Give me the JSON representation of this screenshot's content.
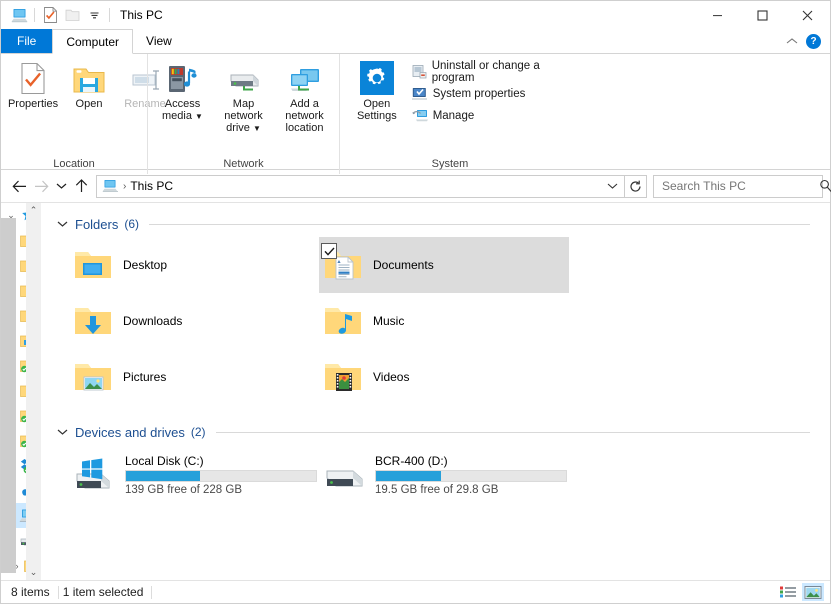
{
  "window": {
    "title": "This PC",
    "quick_access": [
      {
        "name": "this-pc-icon",
        "label": "This PC"
      },
      {
        "name": "properties-icon",
        "label": "Properties"
      },
      {
        "name": "new-folder-icon",
        "label": "New folder"
      },
      {
        "name": "customize-dropdown-icon",
        "label": "Customize Quick Access Toolbar"
      }
    ],
    "controls": {
      "minimize": "Minimize",
      "maximize": "Maximize",
      "close": "Close"
    }
  },
  "tabs": [
    {
      "label": "File",
      "type": "file"
    },
    {
      "label": "Computer",
      "type": "active"
    },
    {
      "label": "View",
      "type": "normal"
    }
  ],
  "tabrow_right": {
    "collapse_label": "Collapse the Ribbon",
    "help_label": "?"
  },
  "ribbon": {
    "groups": [
      {
        "label": "Location",
        "big_buttons": [
          {
            "label": "Properties",
            "icon": "properties-icon",
            "disabled": false,
            "caret": false
          },
          {
            "label": "Open",
            "icon": "open-folder-icon",
            "disabled": false,
            "caret": false
          },
          {
            "label": "Rename",
            "icon": "rename-icon",
            "disabled": true,
            "caret": false
          }
        ]
      },
      {
        "label": "Network",
        "big_buttons": [
          {
            "label": "Access media",
            "icon": "access-media-icon",
            "disabled": false,
            "caret": true
          },
          {
            "label": "Map network drive",
            "icon": "map-network-drive-icon",
            "disabled": false,
            "caret": true
          },
          {
            "label": "Add a network location",
            "icon": "add-network-location-icon",
            "disabled": false,
            "caret": false
          }
        ]
      },
      {
        "label": "System",
        "big_buttons": [
          {
            "label": "Open Settings",
            "icon": "settings-gear-icon",
            "disabled": false,
            "caret": false
          }
        ],
        "small_buttons": [
          {
            "label": "Uninstall or change a program",
            "icon": "uninstall-program-icon"
          },
          {
            "label": "System properties",
            "icon": "system-properties-icon"
          },
          {
            "label": "Manage",
            "icon": "manage-icon"
          }
        ]
      }
    ]
  },
  "addressbar": {
    "back_label": "Back",
    "forward_label": "Forward",
    "recent_label": "Recent locations",
    "up_label": "Up",
    "breadcrumb_icon": "this-pc-icon",
    "breadcrumb": "This PC",
    "separator": "›",
    "dropdown_label": "Previous locations",
    "refresh_label": "Refresh",
    "search_placeholder": "Search This PC",
    "search_value": ""
  },
  "navpane": {
    "items": [
      {
        "name": "quick-access",
        "icon": "star-icon",
        "expander": "v",
        "selected": false
      },
      {
        "name": "folder-1",
        "icon": "folder-icon",
        "expander": "",
        "selected": false
      },
      {
        "name": "folder-2",
        "icon": "folder-icon",
        "expander": "",
        "selected": false
      },
      {
        "name": "folder-3",
        "icon": "folder-icon",
        "expander": "",
        "selected": false
      },
      {
        "name": "folder-4",
        "icon": "folder-icon",
        "expander": "",
        "selected": false
      },
      {
        "name": "desktop",
        "icon": "desktop-folder-icon",
        "expander": "",
        "selected": false
      },
      {
        "name": "synced-folder-1",
        "icon": "folder-synced-icon",
        "expander": "",
        "selected": false
      },
      {
        "name": "folder-5",
        "icon": "folder-icon",
        "expander": "",
        "selected": false
      },
      {
        "name": "synced-folder-2",
        "icon": "folder-synced-icon",
        "expander": "",
        "selected": false
      },
      {
        "name": "synced-folder-3",
        "icon": "folder-synced-icon",
        "expander": "",
        "selected": false
      },
      {
        "name": "dropbox",
        "icon": "dropbox-icon",
        "expander": ">",
        "selected": false
      },
      {
        "name": "onedrive",
        "icon": "onedrive-icon",
        "expander": ">",
        "selected": false
      },
      {
        "name": "this-pc",
        "icon": "this-pc-icon",
        "expander": ">",
        "selected": true
      },
      {
        "name": "drive",
        "icon": "drive-icon",
        "expander": "v",
        "selected": false
      },
      {
        "name": "folder-6",
        "icon": "folder-icon",
        "expander": ">",
        "selected": false
      }
    ]
  },
  "content": {
    "folders_group": {
      "title": "Folders",
      "count": "(6)",
      "chevron": "v"
    },
    "folders": [
      {
        "label": "Desktop",
        "icon": "desktop-folder-icon",
        "selected": false,
        "checked": false
      },
      {
        "label": "Documents",
        "icon": "documents-folder-icon",
        "selected": true,
        "checked": true
      },
      {
        "label": "Downloads",
        "icon": "downloads-folder-icon",
        "selected": false,
        "checked": false
      },
      {
        "label": "Music",
        "icon": "music-folder-icon",
        "selected": false,
        "checked": false
      },
      {
        "label": "Pictures",
        "icon": "pictures-folder-icon",
        "selected": false,
        "checked": false
      },
      {
        "label": "Videos",
        "icon": "videos-folder-icon",
        "selected": false,
        "checked": false
      }
    ],
    "devices_group": {
      "title": "Devices and drives",
      "count": "(2)",
      "chevron": "v"
    },
    "drives": [
      {
        "label": "Local Disk (C:)",
        "icon": "windows-drive-icon",
        "free_text": "139 GB free of 228 GB",
        "used_percent": 39
      },
      {
        "label": "BCR-400 (D:)",
        "icon": "removable-drive-icon",
        "free_text": "19.5 GB free of 29.8 GB",
        "used_percent": 34
      }
    ]
  },
  "statusbar": {
    "items_text": "8 items",
    "selection_text": "1 item selected",
    "details_view_label": "Details view",
    "large_icons_view_label": "Large icons view"
  },
  "colors": {
    "accent": "#0078d7",
    "drive_bar": "#26a0da",
    "group_header": "#1d4f91",
    "selection": "#dcdcdc",
    "nav_selection": "#cce8ff"
  }
}
